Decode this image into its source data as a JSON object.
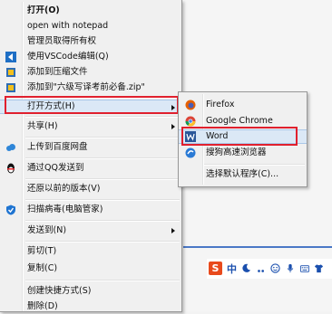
{
  "main_menu": {
    "items": [
      {
        "label": "打开(O)"
      },
      {
        "label": "open with notepad"
      },
      {
        "label": "管理员取得所有权"
      },
      {
        "label": "使用VSCode编辑(Q)"
      },
      {
        "label": "添加到压缩文件"
      },
      {
        "label": "添加到\"六级写译考前必备.zip\""
      },
      {
        "label": "打开方式(H)"
      },
      {
        "label": "共享(H)"
      },
      {
        "label": "上传到百度网盘"
      },
      {
        "label": "通过QQ发送到"
      },
      {
        "label": "还原以前的版本(V)"
      },
      {
        "label": "扫描病毒(电脑管家)"
      },
      {
        "label": "发送到(N)"
      },
      {
        "label": "剪切(T)"
      },
      {
        "label": "复制(C)"
      },
      {
        "label": "创建快捷方式(S)"
      },
      {
        "label": "删除(D)"
      }
    ]
  },
  "sub_menu": {
    "items": [
      {
        "label": "Firefox"
      },
      {
        "label": "Google Chrome"
      },
      {
        "label": "Word"
      },
      {
        "label": "搜狗高速浏览器"
      },
      {
        "label": "选择默认程序(C)..."
      }
    ]
  },
  "ime_bar": {
    "mode_label": "中",
    "logo_letter": "S"
  },
  "colors": {
    "highlight": "#e0202e",
    "hover": "#dbe8f6"
  }
}
